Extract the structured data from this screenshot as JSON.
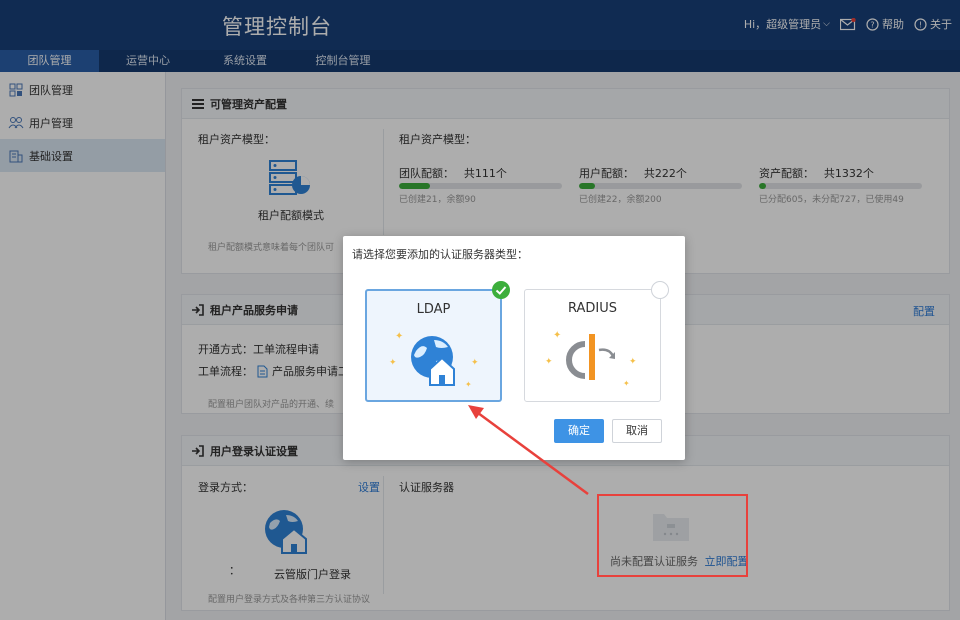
{
  "app_title": "管理控制台",
  "header": {
    "greeting": "Hi，超级管理员",
    "help": "帮助",
    "about": "关于"
  },
  "nav": [
    "团队管理",
    "运营中心",
    "系统设置",
    "控制台管理"
  ],
  "sidebar": [
    {
      "label": "团队管理",
      "icon": "team-grid-icon"
    },
    {
      "label": "用户管理",
      "icon": "users-icon"
    },
    {
      "label": "基础设置",
      "icon": "building-icon"
    }
  ],
  "asset_section": {
    "title": "可管理资产配置",
    "left_label": "租户资产模型：",
    "mode_label": "租户配额模式",
    "desc": "租户配额模式意味着每个团队可",
    "right_label": "租户资产模型：",
    "quotas": [
      {
        "title": "团队配额：",
        "total": "共111个",
        "detail": "已创建21，余额90",
        "fraction": 0.19
      },
      {
        "title": "用户配额：",
        "total": "共222个",
        "detail": "已创建22，余额200",
        "fraction": 0.1
      },
      {
        "title": "资产配额：",
        "total": "共1332个",
        "detail": "已分配605，未分配727，已使用49",
        "fraction": 0.04
      }
    ]
  },
  "product_section": {
    "title": "租户产品服务申请",
    "config": "配置",
    "open_mode_label": "开通方式：",
    "open_mode_value": "工单流程申请",
    "flow_label": "工单流程：",
    "flow_value": "产品服务申请工",
    "desc": "配置租户团队对产品的开通、续"
  },
  "login_section": {
    "title": "用户登录认证设置",
    "login_mode_label": "登录方式：",
    "setting": "设置",
    "auth_server_label": "认证服务器",
    "portal_label": "云管版门户登录",
    "colon": "：",
    "empty_text": "尚未配置认证服务",
    "configure_now": "立即配置",
    "desc": "配置用户登录方式及各种第三方认证协议"
  },
  "dialog": {
    "title": "请选择您要添加的认证服务器类型：",
    "options": [
      {
        "label": "LDAP",
        "selected": true,
        "icon": "globe-house-icon"
      },
      {
        "label": "RADIUS",
        "selected": false,
        "icon": "radius-logo-icon"
      }
    ],
    "confirm": "确定",
    "cancel": "取消"
  },
  "colors": {
    "header": "#18407a",
    "nav_active": "#2a5fa8",
    "accent": "#3e93e5",
    "progress": "#3cae3c",
    "annotation": "#e8413c"
  }
}
